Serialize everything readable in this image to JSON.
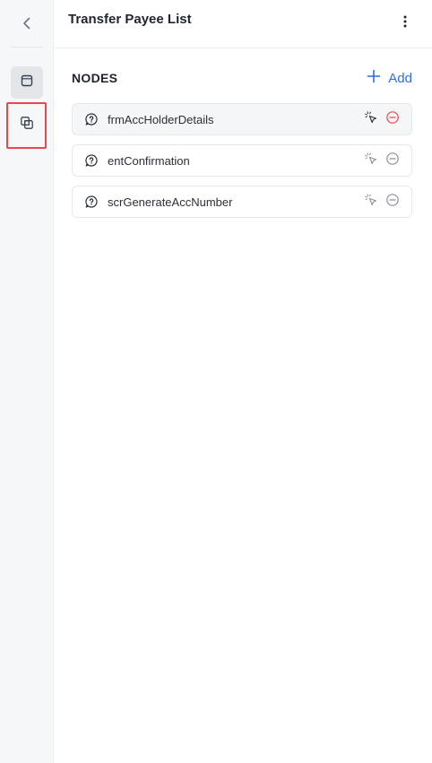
{
  "header": {
    "title": "Transfer Payee List"
  },
  "rail": {
    "back_icon": "chevron-left-icon",
    "items": [
      {
        "icon": "square-icon",
        "active": true
      },
      {
        "icon": "overlap-squares-icon",
        "active": false,
        "highlighted": true
      }
    ]
  },
  "section": {
    "title": "NODES",
    "add_label": "Add"
  },
  "nodes": [
    {
      "label": "frmAccHolderDetails",
      "selected": true
    },
    {
      "label": "entConfirmation",
      "selected": false
    },
    {
      "label": "scrGenerateAccNumber",
      "selected": false
    }
  ],
  "colors": {
    "accent": "#2f6fdf",
    "highlight": "#e5484d",
    "remove_active": "#e5484d",
    "remove_inactive": "#8b9099"
  }
}
